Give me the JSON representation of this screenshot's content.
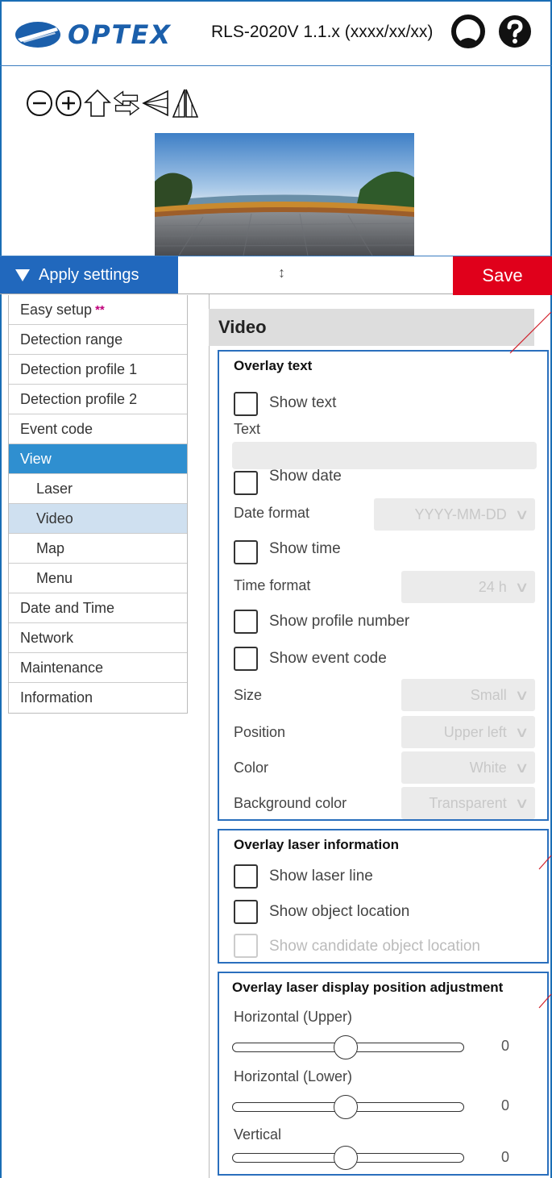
{
  "header": {
    "brand": "OPTEX",
    "version": "RLS-2020V 1.1.x (xxxx/xx/xx)",
    "icons": [
      "user-icon",
      "help-icon"
    ]
  },
  "toolbar": {
    "icons": [
      "zoom-out-icon",
      "zoom-in-icon",
      "home-icon",
      "swap-arrows-icon",
      "triangle-left-icon",
      "mirror-triangle-icon"
    ]
  },
  "apply_bar": {
    "apply_label": "Apply settings",
    "handle": "↕",
    "save_label": "Save"
  },
  "sidebar": {
    "items": [
      {
        "label": "Easy setup",
        "badge": "**"
      },
      {
        "label": "Detection range"
      },
      {
        "label": "Detection profile 1"
      },
      {
        "label": "Detection profile 2"
      },
      {
        "label": "Event code"
      },
      {
        "label": "View"
      },
      {
        "label": "Laser"
      },
      {
        "label": "Video"
      },
      {
        "label": "Map"
      },
      {
        "label": "Menu"
      },
      {
        "label": "Date and Time"
      },
      {
        "label": "Network"
      },
      {
        "label": "Maintenance"
      },
      {
        "label": "Information"
      }
    ]
  },
  "main": {
    "title": "Video",
    "overlay_text": {
      "title": "Overlay text",
      "show_text": "Show text",
      "text_label": "Text",
      "text_value": "",
      "show_date": "Show date",
      "date_format_label": "Date format",
      "date_format_value": "YYYY-MM-DD",
      "show_time": "Show time",
      "time_format_label": "Time format",
      "time_format_value": "24 h",
      "show_profile_number": "Show profile number",
      "show_event_code": "Show event code",
      "size_label": "Size",
      "size_value": "Small",
      "position_label": "Position",
      "position_value": "Upper left",
      "color_label": "Color",
      "color_value": "White",
      "bg_color_label": "Background color",
      "bg_color_value": "Transparent"
    },
    "overlay_laser": {
      "title": "Overlay laser information",
      "show_laser_line": "Show laser line",
      "show_object_location": "Show object location",
      "show_candidate": "Show candidate object location"
    },
    "adjustment": {
      "title": "Overlay laser display position adjustment",
      "horizontal_upper_label": "Horizontal (Upper)",
      "horizontal_upper_value": "0",
      "horizontal_lower_label": "Horizontal (Lower)",
      "horizontal_lower_value": "0",
      "vertical_label": "Vertical",
      "vertical_value": "0"
    }
  },
  "colors": {
    "brand_blue": "#1b5fab",
    "apply_blue": "#2168bd",
    "save_red": "#e0001b",
    "active_item": "#2f8fd0",
    "selected_item": "#cfe0f0"
  }
}
